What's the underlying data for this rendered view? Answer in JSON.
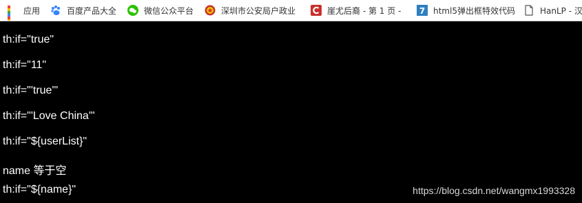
{
  "bookmarks": [
    {
      "label": "应用",
      "icon": "apps-grid-icon"
    },
    {
      "label": "百度产品大全",
      "icon": "baidu-paw-icon"
    },
    {
      "label": "微信公众平台",
      "icon": "wechat-icon"
    },
    {
      "label": "深圳市公安局户政业",
      "icon": "police-badge-icon"
    },
    {
      "label": "崖尤后裔 - 第 1 页 -",
      "icon": "csdn-icon"
    },
    {
      "label": "html5弹出框特效代码",
      "icon": "html5-icon"
    },
    {
      "label": "HanLP - 汉",
      "icon": "document-icon"
    }
  ],
  "lines": [
    "th:if=\"true\"",
    "th:if=\"11\"",
    "th:if=\"'true'\"",
    "th:if=\"'Love China'\"",
    "th:if=\"${userList}\"",
    "name 等于空",
    "th:if=\"${name}\""
  ],
  "watermark": "https://blog.csdn.net/wangmx1993328",
  "colors": {
    "background": "#000000",
    "text": "#ffffff",
    "bookmark_bar": "#ffffff",
    "csdn_red": "#c9302c",
    "wechat_green": "#2dc100",
    "baidu_blue": "#3385ff"
  }
}
